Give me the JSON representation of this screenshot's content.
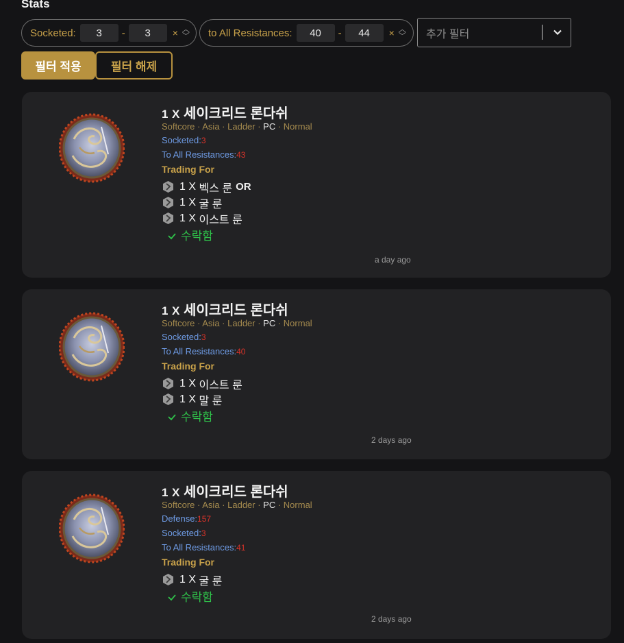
{
  "header": {
    "title": "Stats"
  },
  "filters": [
    {
      "label": "Socketed:",
      "min": "3",
      "max": "3"
    },
    {
      "label": "to All Resistances:",
      "min": "40",
      "max": "44"
    }
  ],
  "add_filter": {
    "placeholder": "추가 필터"
  },
  "buttons": {
    "apply": "필터 적용",
    "clear": "필터 해제"
  },
  "listings": [
    {
      "qty": "1",
      "times": "X",
      "name": "세이크리드 론다쉬",
      "meta": [
        "Softcore",
        "Asia",
        "Ladder",
        "PC",
        "Normal"
      ],
      "stats": [
        {
          "label": "Socketed:",
          "value": "3"
        },
        {
          "label": "To All Resistances:",
          "value": "43"
        }
      ],
      "trading_label": "Trading For",
      "runes": [
        {
          "qty": "1",
          "times": "X",
          "name": "벡스 룬",
          "or": "OR",
          "icon": "vex-rune-icon"
        },
        {
          "qty": "1",
          "times": "X",
          "name": "굴 룬",
          "or": "",
          "icon": "gul-rune-icon"
        },
        {
          "qty": "1",
          "times": "X",
          "name": "이스트 룬",
          "or": "",
          "icon": "ist-rune-icon"
        }
      ],
      "status": "수락함",
      "time": "a day ago"
    },
    {
      "qty": "1",
      "times": "X",
      "name": "세이크리드 론다쉬",
      "meta": [
        "Softcore",
        "Asia",
        "Ladder",
        "PC",
        "Normal"
      ],
      "stats": [
        {
          "label": "Socketed:",
          "value": "3"
        },
        {
          "label": "To All Resistances:",
          "value": "40"
        }
      ],
      "trading_label": "Trading For",
      "runes": [
        {
          "qty": "1",
          "times": "X",
          "name": "이스트 룬",
          "or": "",
          "icon": "ist-rune-icon"
        },
        {
          "qty": "1",
          "times": "X",
          "name": "말 룬",
          "or": "",
          "icon": "mal-rune-icon"
        }
      ],
      "status": "수락함",
      "time": "2 days ago"
    },
    {
      "qty": "1",
      "times": "X",
      "name": "세이크리드 론다쉬",
      "meta": [
        "Softcore",
        "Asia",
        "Ladder",
        "PC",
        "Normal"
      ],
      "stats": [
        {
          "label": "Defense:",
          "value": "157"
        },
        {
          "label": "Socketed:",
          "value": "3"
        },
        {
          "label": "To All Resistances:",
          "value": "41"
        }
      ],
      "trading_label": "Trading For",
      "runes": [
        {
          "qty": "1",
          "times": "X",
          "name": "굴 룬",
          "or": "",
          "icon": "gul-rune-icon"
        }
      ],
      "status": "수락함",
      "time": "2 days ago"
    }
  ]
}
